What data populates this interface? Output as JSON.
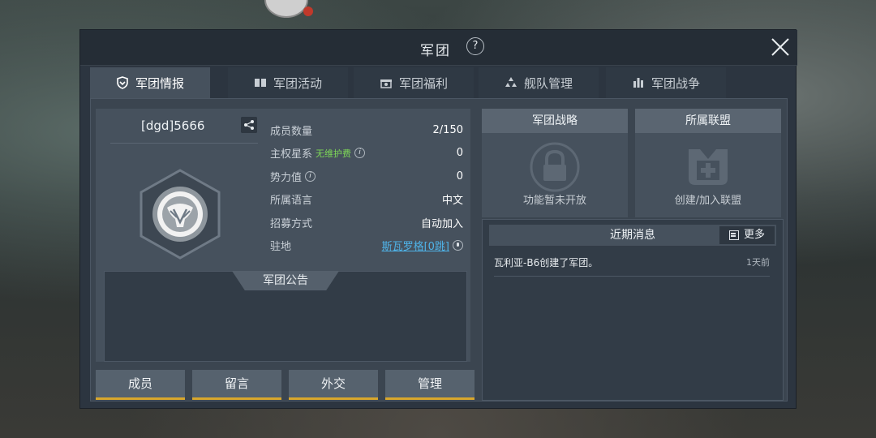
{
  "window": {
    "title": "军团",
    "help": "?"
  },
  "tabs": [
    {
      "label": "军团情报",
      "icon": "shield-icon",
      "active": true
    },
    {
      "label": "军团活动",
      "icon": "book-icon",
      "active": false
    },
    {
      "label": "军团福利",
      "icon": "gift-icon",
      "active": false
    },
    {
      "label": "舰队管理",
      "icon": "fleet-icon",
      "active": false
    },
    {
      "label": "军团战争",
      "icon": "war-icon",
      "active": false
    }
  ],
  "guild": {
    "name": "[dgd]5666",
    "notice_title": "军团公告"
  },
  "stats": {
    "members": {
      "label": "成员数量",
      "value": "2/150"
    },
    "sovereignty": {
      "label": "主权星系",
      "badge": "无维护费",
      "value": "0"
    },
    "power": {
      "label": "势力值",
      "value": "0"
    },
    "language": {
      "label": "所属语言",
      "value": "中文"
    },
    "recruit": {
      "label": "招募方式",
      "value": "自动加入"
    },
    "station": {
      "label": "驻地",
      "value": "斯瓦罗格[0跳]"
    }
  },
  "bottom_buttons": [
    "成员",
    "留言",
    "外交",
    "管理"
  ],
  "cards": {
    "strategy": {
      "title": "军团战略",
      "caption": "功能暂未开放"
    },
    "alliance": {
      "title": "所属联盟",
      "caption": "创建/加入联盟"
    }
  },
  "news": {
    "title": "近期消息",
    "more": "更多",
    "items": [
      {
        "text": "瓦利亚-B6创建了军团。",
        "time": "1天前"
      }
    ]
  },
  "colors": {
    "accent_yellow": "#d8a72c",
    "link_blue": "#4fb3e8",
    "badge_green": "#7ed957"
  }
}
